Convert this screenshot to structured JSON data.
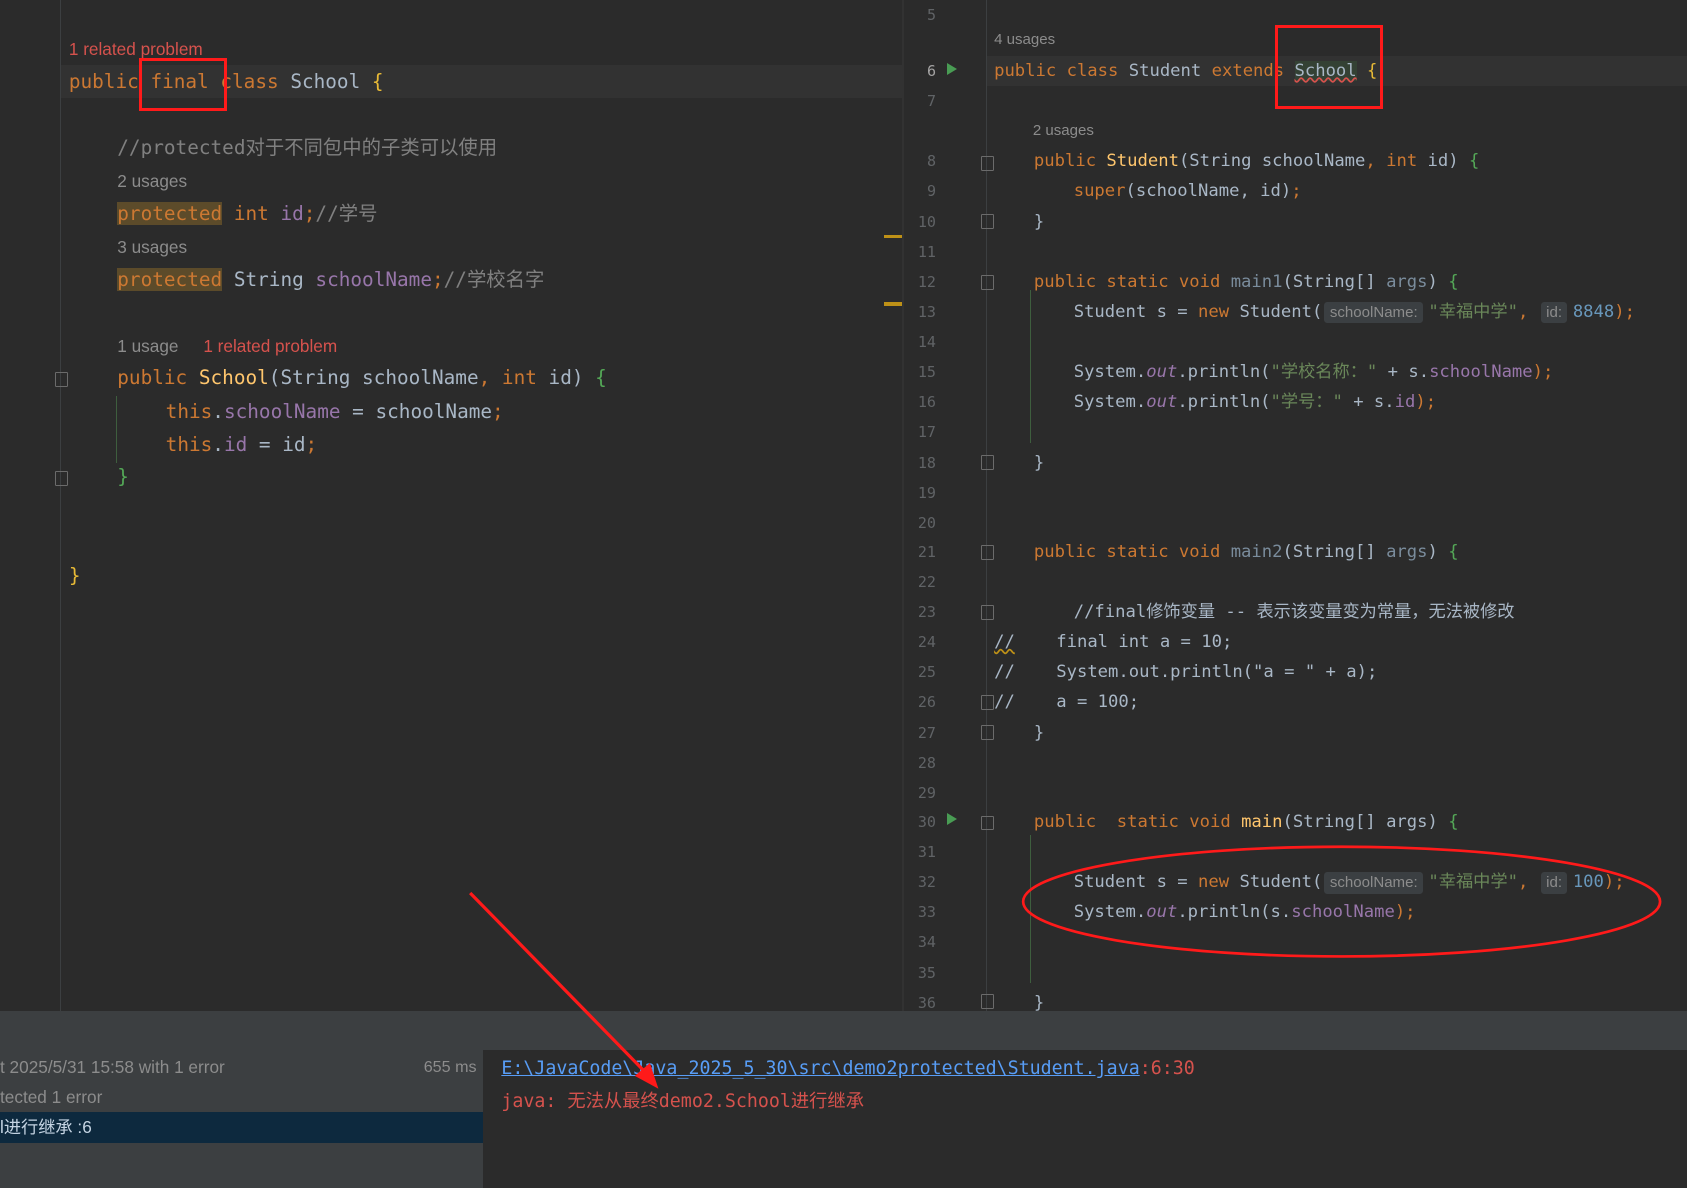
{
  "left": {
    "problem_top": "1 related problem",
    "class_line": {
      "kw_public": "public",
      "kw_final": "final",
      "kw_class": "class",
      "name": "School",
      "brace": "{"
    },
    "comment_protected": "//protected对于不同包中的子类可以使用",
    "usages_id": "2 usages",
    "field_id": {
      "mod": "protected",
      "type": "int",
      "name": "id",
      "tail": ";",
      "comment": "//学号"
    },
    "usages_school": "3 usages",
    "field_school": {
      "mod": "protected",
      "type": "String",
      "name": "schoolName",
      "tail": ";",
      "comment": "//学校名字"
    },
    "ctor_usage": "1 usage",
    "ctor_problem": "1 related problem",
    "ctor_sig": {
      "kw_public": "public",
      "name": "School",
      "open": "(",
      "p1_type": "String",
      "p1_name": "schoolName",
      "comma": ",",
      "p2_type": "int",
      "p2_name": "id",
      "close": ")",
      "brace": "{"
    },
    "assign1": {
      "kw_this": "this",
      "dot": ".",
      "field": "schoolName",
      "rest": " = schoolName",
      "semi": ";"
    },
    "assign2": {
      "kw_this": "this",
      "dot": ".",
      "field": "id",
      "rest": " = id",
      "semi": ";"
    },
    "close_ctor": "}",
    "close_class": "}"
  },
  "right": {
    "line_numbers": [
      "5",
      "6",
      "7",
      "8",
      "9",
      "10",
      "11",
      "12",
      "13",
      "14",
      "15",
      "16",
      "17",
      "18",
      "19",
      "20",
      "21",
      "22",
      "23",
      "24",
      "25",
      "26",
      "27",
      "28",
      "29",
      "30",
      "31",
      "32",
      "33",
      "34",
      "35",
      "36"
    ],
    "usages_class": "4 usages",
    "class_line": {
      "kw": "public class",
      "name": "Student",
      "kw_extends": "extends",
      "parent": "School",
      "brace": "{"
    },
    "usages_ctor": "2 usages",
    "ctor_sig": {
      "kw": "public",
      "name": "Student",
      "open": "(",
      "p1_type": "String",
      "p1_name": "schoolName",
      "comma": ",",
      "p2_type": "int",
      "p2_name": "id",
      "close": ")",
      "brace": "{"
    },
    "super_call": {
      "kw": "super",
      "args": "(schoolName, id)",
      "semi": ";"
    },
    "close_brace": "}",
    "main1_sig": {
      "kw": "public static void",
      "name": "main1",
      "open": "(",
      "type": "String[]",
      "param": "args",
      "close": ")",
      "brace": "{"
    },
    "m1_new": {
      "type": "Student s = ",
      "kw_new": "new",
      "ctor": " Student(",
      "hint1": "schoolName:",
      "str": "\"幸福中学\"",
      "comma": ",",
      "hint2": "id:",
      "num": "8848",
      "end": ");"
    },
    "m1_print1": {
      "pre": "System.",
      "out": "out",
      "mid": ".println(",
      "str": "\"学校名称：\"",
      "plus": " + s.",
      "field": "schoolName",
      "end": ");"
    },
    "m1_print2": {
      "pre": "System.",
      "out": "out",
      "mid": ".println(",
      "str": "\"学号：\"",
      "plus": " + s.",
      "field": "id",
      "end": ");"
    },
    "main2_sig": {
      "kw": "public static void",
      "name": "main2",
      "open": "(",
      "type": "String[]",
      "param": "args",
      "close": ")",
      "brace": "{"
    },
    "comment_final": "//final修饰变量 -- 表示该变量变为常量，无法被修改",
    "commented": [
      {
        "slashes": "//",
        "code": "    final int a = 10;"
      },
      {
        "slashes": "//",
        "code": "    System.out.println(\"a = \" + a);"
      },
      {
        "slashes": "//",
        "code": "    a = 100;"
      }
    ],
    "main_sig": {
      "kw": "public  static void",
      "name": "main",
      "open": "(",
      "type": "String[]",
      "param": "args",
      "close": ")",
      "brace": "{"
    },
    "m_new": {
      "type": "Student s = ",
      "kw_new": "new",
      "ctor": " Student(",
      "hint1": "schoolName:",
      "str": "\"幸福中学\"",
      "comma": ",",
      "hint2": "id:",
      "num": "100",
      "end": ");"
    },
    "m_print": {
      "pre": "System.",
      "out": "out",
      "mid": ".println(s.",
      "field": "schoolName",
      "end": ");"
    }
  },
  "build": {
    "rows": [
      {
        "text": "t 2025/5/31 15:58 with 1 error",
        "time": "655 ms"
      },
      {
        "text": "tected 1 error"
      },
      {
        "text": "l进行继承 :6"
      }
    ]
  },
  "output": {
    "path": "E:\\JavaCode\\Java_2025_5_30\\src\\demo2protected\\Student.java",
    "loc": ":6:30",
    "error_prefix": "java: ",
    "error_cn1": "无法从最终",
    "error_class": "demo2.School",
    "error_cn2": "进行继承"
  },
  "colors": {
    "keyword": "#cc7832",
    "method": "#ffc66d",
    "field": "#9876aa",
    "string": "#6a8759",
    "number": "#6897bb",
    "comment": "#808080",
    "error": "#d6524d",
    "annotation_red": "#ff1a1a"
  }
}
